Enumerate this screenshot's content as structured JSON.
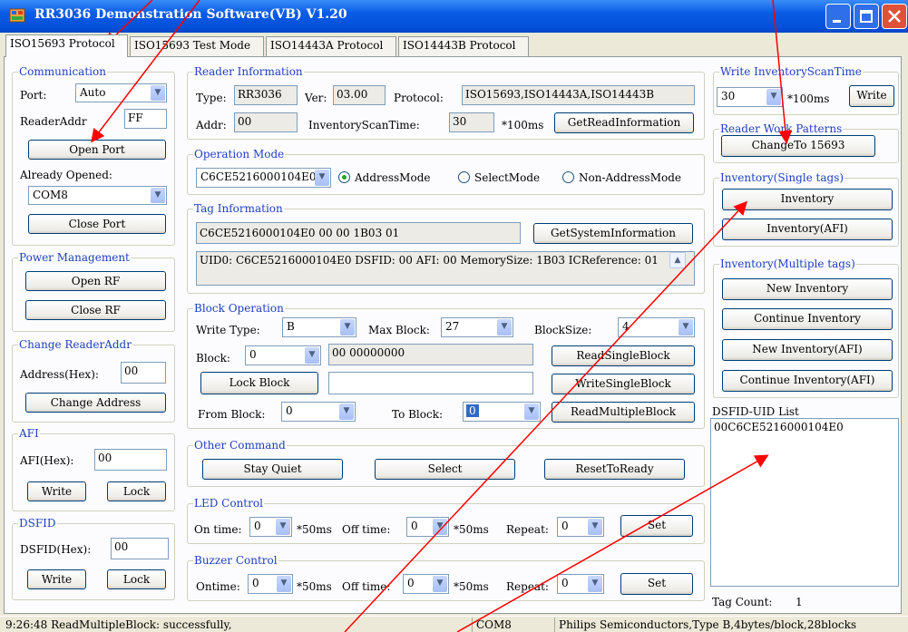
{
  "window": {
    "title": "RR3036 Demonstration Software(VB) V1.20"
  },
  "tabs": [
    "ISO15693 Protocol",
    "ISO15693 Test Mode",
    "ISO14443A Protocol",
    "ISO14443B Protocol"
  ],
  "communication": {
    "legend": "Communication",
    "port_label": "Port:",
    "port_value": "Auto",
    "reader_addr_label": "ReaderAddr",
    "reader_addr_value": "FF",
    "open_port": "Open Port",
    "already_opened_label": "Already Opened:",
    "opened_port": "COM8",
    "close_port": "Close Port"
  },
  "power": {
    "legend": "Power Management",
    "open_rf": "Open RF",
    "close_rf": "Close RF"
  },
  "change_addr": {
    "legend": "Change ReaderAddr",
    "address_label": "Address(Hex):",
    "address_value": "00",
    "button": "Change Address"
  },
  "afi": {
    "legend": "AFI",
    "afi_label": "AFI(Hex):",
    "afi_value": "00",
    "write": "Write",
    "lock": "Lock"
  },
  "dsfid": {
    "legend": "DSFID",
    "dsfid_label": "DSFID(Hex):",
    "dsfid_value": "00",
    "write": "Write",
    "lock": "Lock"
  },
  "reader_info": {
    "legend": "Reader Information",
    "type_label": "Type:",
    "type_value": "RR3036",
    "ver_label": "Ver:",
    "ver_value": "03.00",
    "protocol_label": "Protocol:",
    "protocol_value": "ISO15693,ISO14443A,ISO14443B",
    "addr_label": "Addr:",
    "addr_value": "00",
    "inv_time_label": "InventoryScanTime:",
    "inv_time_value": "30",
    "inv_time_unit": "*100ms",
    "get_info": "GetReadInformation"
  },
  "operation_mode": {
    "legend": "Operation Mode",
    "uid_value": "C6CE5216000104E0",
    "modes": [
      "AddressMode",
      "SelectMode",
      "Non-AddressMode"
    ],
    "selected": "AddressMode"
  },
  "tag_info": {
    "legend": "Tag Information",
    "tag_value": "C6CE5216000104E0 00 00 1B03 01",
    "get_system": "GetSystemInformation",
    "details": "UID0: C6CE5216000104E0 DSFID: 00 AFI: 00 MemorySize: 1B03 ICReference: 01"
  },
  "block_op": {
    "legend": "Block Operation",
    "write_type_label": "Write Type:",
    "write_type_value": "B",
    "max_block_label": "Max Block:",
    "max_block_value": "27",
    "block_size_label": "BlockSize:",
    "block_size_value": "4",
    "block_label": "Block:",
    "block_value": "0",
    "block_data": "00 00000000",
    "read_single": "ReadSingleBlock",
    "lock_block": "Lock Block",
    "write_data": "",
    "write_single": "WriteSingleBlock",
    "from_label": "From Block:",
    "from_value": "0",
    "to_label": "To Block:",
    "to_value": "0",
    "read_multiple": "ReadMultipleBlock"
  },
  "other_cmd": {
    "legend": "Other Command",
    "stay_quiet": "Stay Quiet",
    "select": "Select",
    "reset": "ResetToReady"
  },
  "led": {
    "legend": "LED Control",
    "on_label": "On time:",
    "on_value": "0",
    "unit1": "*50ms",
    "off_label": "Off time:",
    "off_value": "0",
    "unit2": "*50ms",
    "repeat_label": "Repeat:",
    "repeat_value": "0",
    "set": "Set"
  },
  "buzzer": {
    "legend": "Buzzer Control",
    "on_label": "Ontime:",
    "on_value": "0",
    "unit1": "*50ms",
    "off_label": "Off time:",
    "off_value": "0",
    "unit2": "*50ms",
    "repeat_label": "Repeat:",
    "repeat_value": "0",
    "set": "Set"
  },
  "write_scan": {
    "legend": "Write InventoryScanTime",
    "value": "30",
    "unit": "*100ms",
    "write": "Write"
  },
  "work_patterns": {
    "legend": "Reader Work Patterns",
    "button": "ChangeTo 15693"
  },
  "inv_single": {
    "legend": "Inventory(Single tags)",
    "inventory": "Inventory",
    "inventory_afi": "Inventory(AFI)"
  },
  "inv_multi": {
    "legend": "Inventory(Multiple tags)",
    "new_inv": "New Inventory",
    "continue_inv": "Continue Inventory",
    "new_inv_afi": "New Inventory(AFI)",
    "continue_inv_afi": "Continue Inventory(AFI)"
  },
  "uid_list": {
    "label": "DSFID-UID List",
    "items": [
      "00C6CE5216000104E0"
    ],
    "tag_count_label": "Tag Count:",
    "tag_count": "1"
  },
  "status": {
    "message": "9:26:48 ReadMultipleBlock: successfully,",
    "port": "COM8",
    "info": "Philips Semiconductors,Type B,4bytes/block,28blocks"
  },
  "colors": {
    "title_bar": "#0a5ce6",
    "legend": "#1f3fbf",
    "annotation_arrows": "#ff0000"
  }
}
